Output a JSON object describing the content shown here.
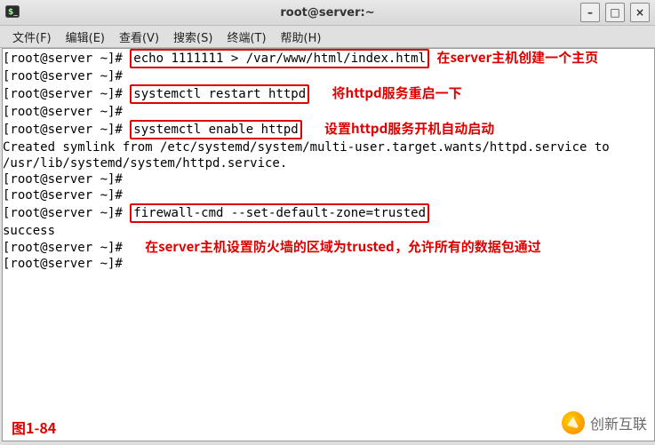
{
  "window": {
    "title": "root@server:~",
    "icon": "terminal-icon",
    "controls": {
      "min": "–",
      "max": "□",
      "close": "×"
    }
  },
  "menubar": {
    "file": "文件(F)",
    "edit": "编辑(E)",
    "view": "查看(V)",
    "search": "搜索(S)",
    "terminal": "终端(T)",
    "help": "帮助(H)"
  },
  "prompt": "[root@server ~]#",
  "lines": {
    "l0_cmd": "echo 1111111 > /var/www/html/index.html",
    "l0_anno": "在server主机创建一个主页",
    "l2_cmd": "systemctl restart httpd",
    "l2_anno": "将httpd服务重启一下",
    "l4_cmd": "systemctl enable httpd",
    "l4_anno": "设置httpd服务开机自动启动",
    "l5_out": "Created symlink from /etc/systemd/system/multi-user.target.wants/httpd.service to /usr/lib/systemd/system/httpd.service.",
    "l8_cmd": "firewall-cmd --set-default-zone=trusted",
    "l9_out": "success",
    "l9_anno": "在server主机设置防火墙的区域为trusted，允许所有的数据包通过"
  },
  "figure_label": "图1-84",
  "watermark_text": "创新互联"
}
